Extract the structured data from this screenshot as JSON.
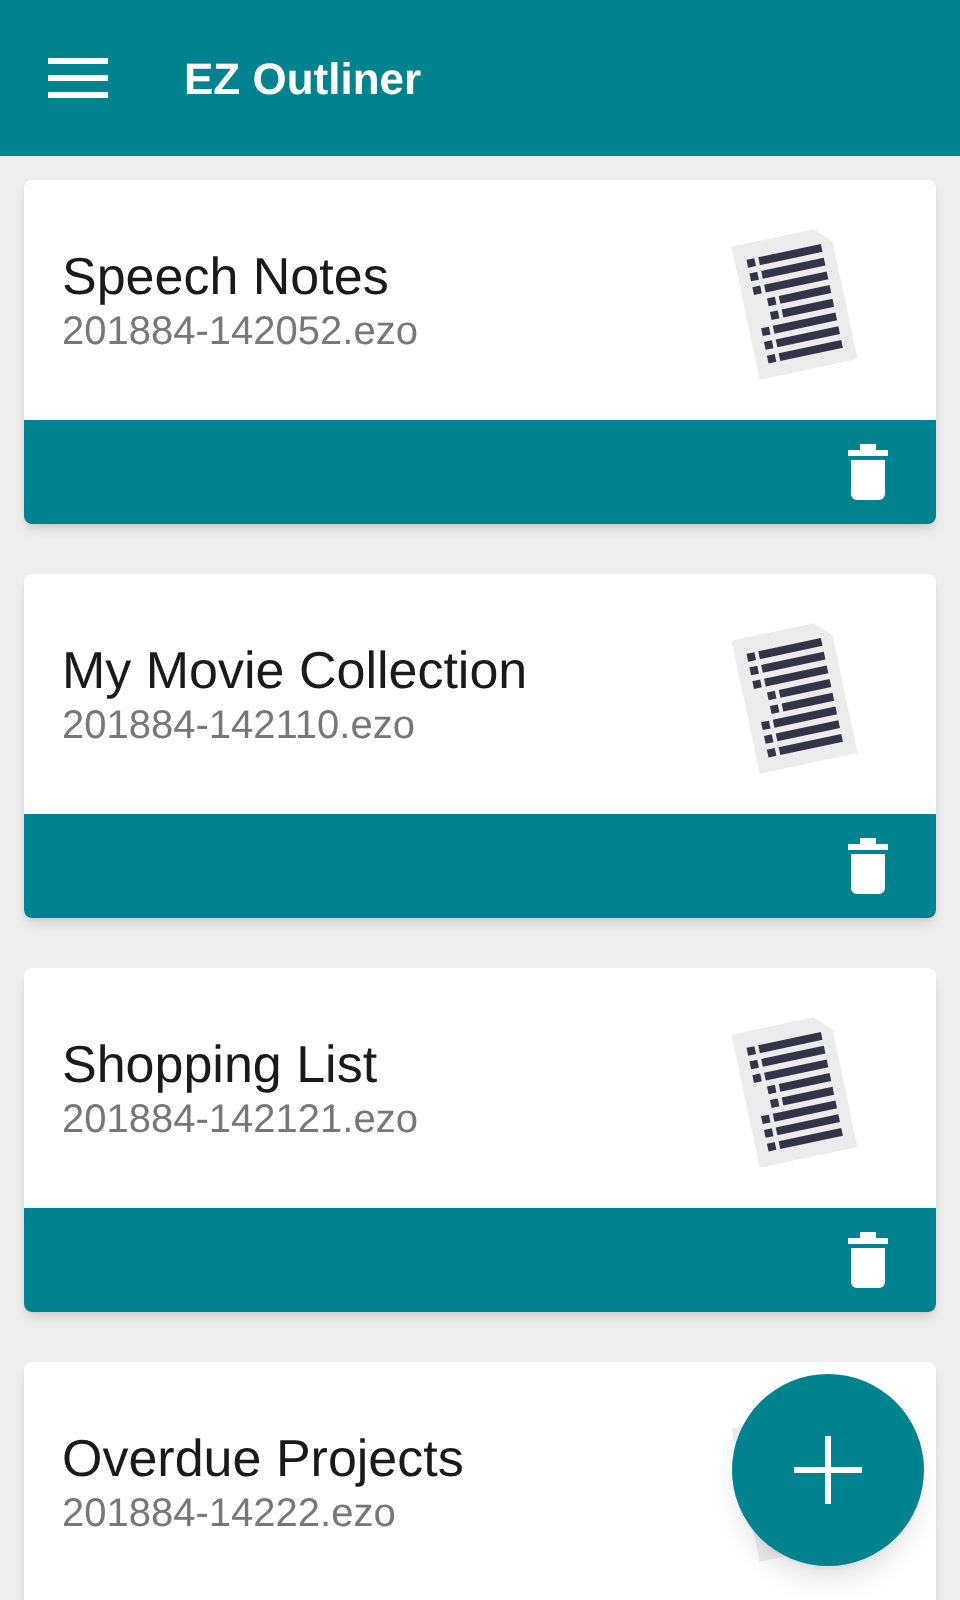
{
  "app_bar": {
    "title": "EZ Outliner"
  },
  "files": [
    {
      "title": "Speech Notes",
      "filename": "201884-142052.ezo"
    },
    {
      "title": "My Movie Collection",
      "filename": "201884-142110.ezo"
    },
    {
      "title": "Shopping List",
      "filename": "201884-142121.ezo"
    },
    {
      "title": "Overdue Projects",
      "filename": "201884-14222.ezo"
    }
  ]
}
